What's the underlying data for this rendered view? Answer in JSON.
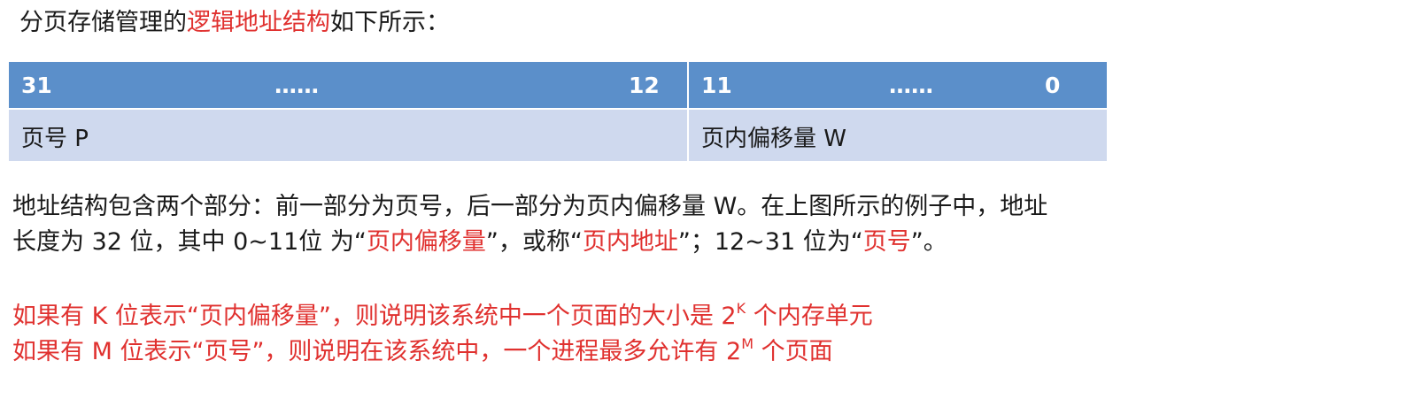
{
  "intro": {
    "before": "分页存储管理的",
    "highlight": "逻辑地址结构",
    "after": "如下所示："
  },
  "table": {
    "left_bits": {
      "high": "31",
      "dots": "……",
      "low": "12"
    },
    "right_bits": {
      "high": "11",
      "dots": "……",
      "low": "0"
    },
    "left_label": "页号 P",
    "right_label": "页内偏移量 W"
  },
  "paragraph": {
    "line1": "地址结构包含两个部分：前一部分为页号，后一部分为页内偏移量 W。在上图所示的例子中，地址",
    "line2_a": "长度为 32 位，其中 0~11位 为“",
    "line2_r1": "页内偏移量",
    "line2_b": "”，或称“",
    "line2_r2": "页内地址",
    "line2_c": "”；12~31 位为“",
    "line2_r3": "页号",
    "line2_d": "”。"
  },
  "notes": {
    "line1_a": "如果有 K 位表示“页内偏移量”，则说明该系统中一个页面的大小是 2",
    "line1_sup": "K",
    "line1_b": " 个内存单元",
    "line2_a": "如果有 M 位表示“页号”，则说明在该系统中，一个进程最多允许有 2",
    "line2_sup": "M",
    "line2_b": " 个页面"
  },
  "colors": {
    "accent_red": "#e0312f",
    "header_blue": "#5b8fca",
    "label_bg": "#cfd9ee"
  }
}
